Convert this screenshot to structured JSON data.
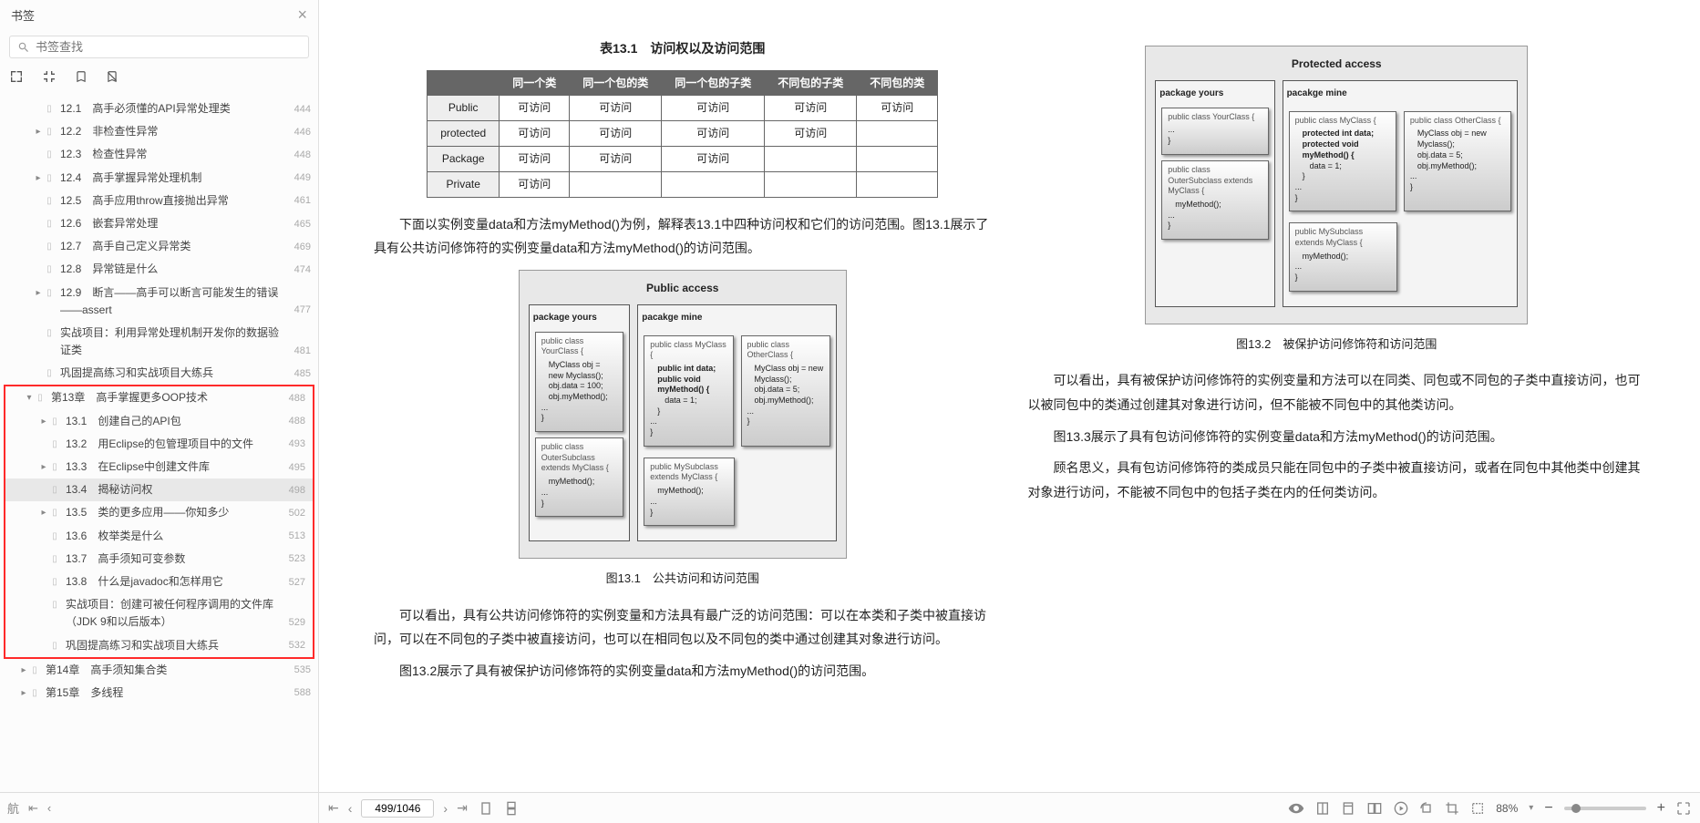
{
  "sidebar": {
    "title": "书签",
    "search_placeholder": "书签查找",
    "items_top": [
      {
        "label": "12.1　高手必须懂的API异常处理类",
        "page": "444",
        "arrow": false
      },
      {
        "label": "12.2　非检查性异常",
        "page": "446",
        "arrow": true
      },
      {
        "label": "12.3　检查性异常",
        "page": "448",
        "arrow": false
      },
      {
        "label": "12.4　高手掌握异常处理机制",
        "page": "449",
        "arrow": true
      },
      {
        "label": "12.5　高手应用throw直接抛出异常",
        "page": "461",
        "arrow": false
      },
      {
        "label": "12.6　嵌套异常处理",
        "page": "465",
        "arrow": false
      },
      {
        "label": "12.7　高手自己定义异常类",
        "page": "469",
        "arrow": false
      },
      {
        "label": "12.8　异常链是什么",
        "page": "474",
        "arrow": false
      },
      {
        "label": "12.9　断言——高手可以断言可能发生的错误——assert",
        "page": "477",
        "arrow": true
      },
      {
        "label": "实战项目：利用异常处理机制开发你的数据验证类",
        "page": "481",
        "arrow": false
      },
      {
        "label": "巩固提高练习和实战项目大练兵",
        "page": "485",
        "arrow": false
      }
    ],
    "chapter13": {
      "label": "第13章　高手掌握更多OOP技术",
      "page": "488"
    },
    "items_ch13": [
      {
        "label": "13.1　创建自己的API包",
        "page": "488",
        "arrow": true
      },
      {
        "label": "13.2　用Eclipse的包管理项目中的文件",
        "page": "493",
        "arrow": false
      },
      {
        "label": "13.3　在Eclipse中创建文件库",
        "page": "495",
        "arrow": true
      },
      {
        "label": "13.4　揭秘访问权",
        "page": "498",
        "arrow": false,
        "selected": true
      },
      {
        "label": "13.5　类的更多应用——你知多少",
        "page": "502",
        "arrow": true
      },
      {
        "label": "13.6　枚举类是什么",
        "page": "513",
        "arrow": false
      },
      {
        "label": "13.7　高手须知可变参数",
        "page": "523",
        "arrow": false
      },
      {
        "label": "13.8　什么是javadoc和怎样用它",
        "page": "527",
        "arrow": false
      },
      {
        "label": "实战项目：创建可被任何程序调用的文件库（JDK 9和以后版本）",
        "page": "529",
        "arrow": false
      },
      {
        "label": "巩固提高练习和实战项目大练兵",
        "page": "532",
        "arrow": false
      }
    ],
    "items_bottom": [
      {
        "label": "第14章　高手须知集合类",
        "page": "535"
      },
      {
        "label": "第15章　多线程",
        "page": "588"
      }
    ],
    "side_nav_label": "航"
  },
  "doc": {
    "left": {
      "table_title": "表13.1　访问权以及访问范围",
      "headers": [
        "",
        "同一个类",
        "同一个包的类",
        "同一个包的子类",
        "不同包的子类",
        "不同包的类"
      ],
      "rows": [
        {
          "h": "Public",
          "c": [
            "可访问",
            "可访问",
            "可访问",
            "可访问",
            "可访问"
          ]
        },
        {
          "h": "protected",
          "c": [
            "可访问",
            "可访问",
            "可访问",
            "可访问",
            ""
          ]
        },
        {
          "h": "Package",
          "c": [
            "可访问",
            "可访问",
            "可访问",
            "",
            ""
          ]
        },
        {
          "h": "Private",
          "c": [
            "可访问",
            "",
            "",
            "",
            ""
          ]
        }
      ],
      "p1": "下面以实例变量data和方法myMethod()为例，解释表13.1中四种访问权和它们的访问范围。图13.1展示了具有公共访问修饰符的实例变量data和方法myMethod()的访问范围。",
      "diagram1": {
        "title": "Public access",
        "col1": "package yours",
        "col2": "pacakge mine",
        "c1a_head": "public class YourClass {",
        "c1a_b1": "MyClass obj = new Myclass();",
        "c1a_b2": "obj.data = 100;",
        "c1a_b3": "obj.myMethod();",
        "dots": "...",
        "c1b_head": "public class OuterSubclass extends MyClass {",
        "c1b_b1": "myMethod();",
        "c2a_head": "public class MyClass {",
        "c2a_b1": "public int data;",
        "c2a_b2": "public void myMethod() {",
        "c2a_b3": "data = 1;",
        "close": "}",
        "c2b_head": "public MySubclass extends MyClass {",
        "c2b_b1": "myMethod();",
        "c3a_head": "public class OtherClass {",
        "c3a_b1": "MyClass obj = new Myclass();",
        "c3a_b2": "obj.data = 5;",
        "c3a_b3": "obj.myMethod();"
      },
      "cap1": "图13.1　公共访问和访问范围",
      "p2": "可以看出，具有公共访问修饰符的实例变量和方法具有最广泛的访问范围：可以在本类和子类中被直接访问，可以在不同包的子类中被直接访问，也可以在相同包以及不同包的类中通过创建其对象进行访问。",
      "p3": "图13.2展示了具有被保护访问修饰符的实例变量data和方法myMethod()的访问范围。"
    },
    "right": {
      "diagram2": {
        "title": "Protected access",
        "col1": "package yours",
        "col2": "pacakge mine",
        "c1a_head": "public class YourClass {",
        "dots": "...",
        "c1b_head": "public class OuterSubclass extends MyClass {",
        "c1b_b1": "myMethod();",
        "c2a_head": "public class MyClass {",
        "c2a_b1": "protected int data;",
        "c2a_b2": "protected void myMethod() {",
        "c2a_b3": "data = 1;",
        "close": "}",
        "c2b_head": "public MySubclass extends MyClass {",
        "c2b_b1": "myMethod();",
        "c3a_head": "public class OtherClass {",
        "c3a_b1": "MyClass obj = new Myclass();",
        "c3a_b2": "obj.data = 5;",
        "c3a_b3": "obj.myMethod();"
      },
      "cap2": "图13.2　被保护访问修饰符和访问范围",
      "p4": "可以看出，具有被保护访问修饰符的实例变量和方法可以在同类、同包或不同包的子类中直接访问，也可以被同包中的类通过创建其对象进行访问，但不能被不同包中的其他类访问。",
      "p5": "图13.3展示了具有包访问修饰符的实例变量data和方法myMethod()的访问范围。",
      "p6": "顾名思义，具有包访问修饰符的类成员只能在同包中的子类中被直接访问，或者在同包中其他类中创建其对象进行访问，不能被不同包中的包括子类在内的任何类访问。"
    }
  },
  "statusbar": {
    "page_display": "499/1046",
    "zoom": "88%"
  }
}
